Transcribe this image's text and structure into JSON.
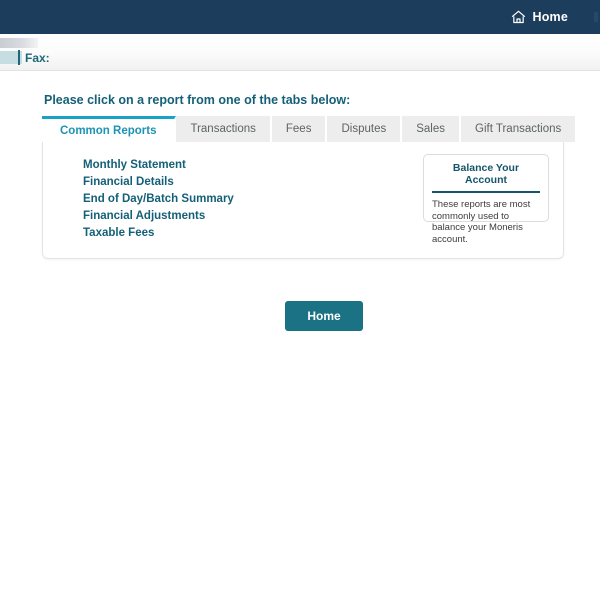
{
  "topbar": {
    "home_label": "Home",
    "home_icon": "house-icon",
    "background_color": "#1d3d5c"
  },
  "infobar": {
    "fax_label": "Fax:"
  },
  "main": {
    "lead_text": "Please click on a report from one of the tabs below:",
    "tabs": [
      {
        "label": "Common Reports",
        "active": true
      },
      {
        "label": "Transactions",
        "active": false
      },
      {
        "label": "Fees",
        "active": false
      },
      {
        "label": "Disputes",
        "active": false
      },
      {
        "label": "Sales",
        "active": false
      },
      {
        "label": "Gift Transactions",
        "active": false
      }
    ],
    "report_links": [
      "Monthly Statement",
      "Financial Details",
      "End of Day/Batch Summary",
      "Financial Adjustments",
      "Taxable Fees"
    ],
    "callout": {
      "title": "Balance Your Account",
      "body": "These reports are most commonly used to balance your Moneris account."
    },
    "home_button_label": "Home"
  },
  "colors": {
    "navy": "#1d3d5c",
    "teal_dark": "#156079",
    "cyan_accent": "#16a3c7",
    "button_teal": "#1b7285"
  }
}
